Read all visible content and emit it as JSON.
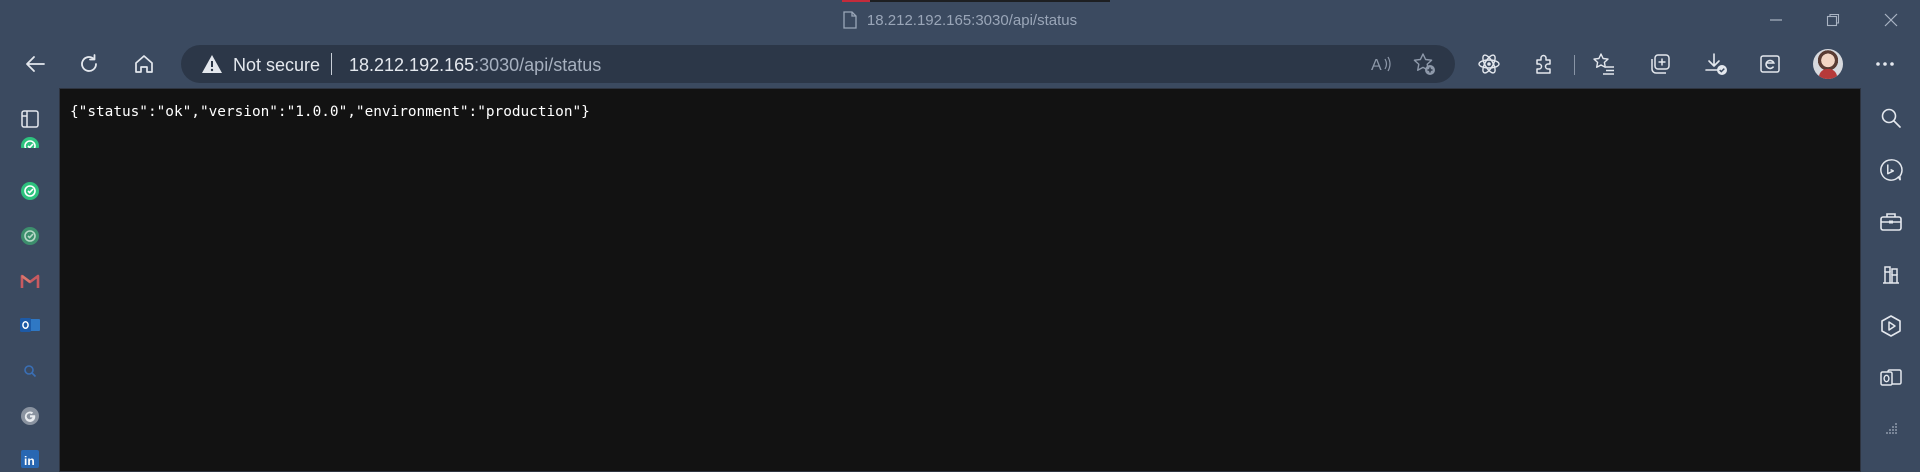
{
  "window": {
    "title": "18.212.192.165:3030/api/status"
  },
  "toolbar": {
    "back_icon": "arrow-left-icon",
    "refresh_icon": "refresh-icon",
    "home_icon": "home-icon",
    "security_label": "Not secure",
    "url_host": "18.212.192.165",
    "url_path": ":3030/api/status",
    "extensions": [
      "read-aloud-icon",
      "add-favorite-icon",
      "react-devtools-icon",
      "extensions-icon",
      "favorites-icon",
      "collections-icon",
      "downloads-icon",
      "ie-mode-icon",
      "profile-avatar",
      "more-icon"
    ]
  },
  "left_sidebar": {
    "items": [
      "tab-actions-icon",
      "site-check-icon",
      "site-check-icon",
      "site-check-icon",
      "gmail-icon",
      "outlook-icon",
      "search-icon",
      "google-icon",
      "linkedin-icon"
    ]
  },
  "right_sidebar": {
    "items": [
      "search-icon",
      "bing-chat-icon",
      "tools-icon",
      "games-icon",
      "office-icon",
      "outlook-icon",
      "more-apps-icon"
    ]
  },
  "page": {
    "body_text": "{\"status\":\"ok\",\"version\":\"1.0.0\",\"environment\":\"production\"}"
  },
  "colors": {
    "chrome_bg": "#3b4a60",
    "omnibox_bg": "#2c3748",
    "content_bg": "#121212",
    "content_text": "#ffffff",
    "icon_green": "#2ec27e"
  }
}
